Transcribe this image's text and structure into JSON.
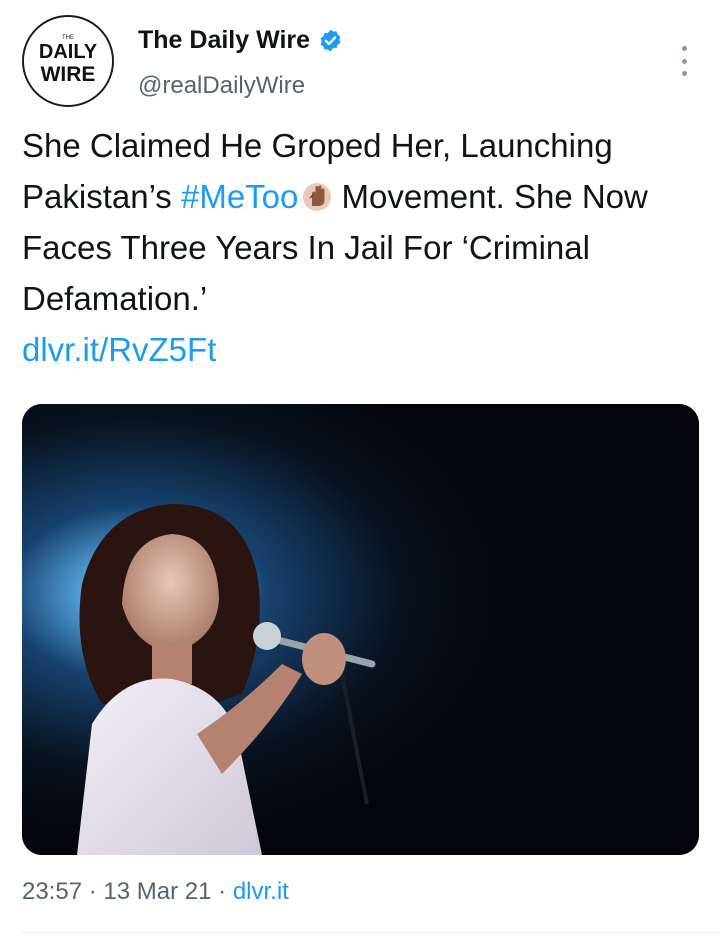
{
  "author": {
    "name": "The Daily Wire",
    "handle": "@realDailyWire",
    "avatar_text_top": "DAILY",
    "avatar_text_bottom": "WIRE",
    "avatar_text_small": "THE",
    "verified": true
  },
  "tweet": {
    "text_part1": "She Claimed He Groped Her, Launching Pakistan’s ",
    "hashtag": "#MeToo",
    "text_part2": " Movement. She Now Faces Three Years In Jail For ‘Criminal Defamation.’",
    "link": "dlvr.it/RvZ5Ft",
    "emoji": "raised-hand-icon"
  },
  "meta": {
    "time": "23:57",
    "separator": "·",
    "date": "13 Mar 21",
    "source": "dlvr.it"
  },
  "colors": {
    "accent": "#1d9bf0",
    "secondary_text": "#536471",
    "primary_text": "#0f1419"
  }
}
